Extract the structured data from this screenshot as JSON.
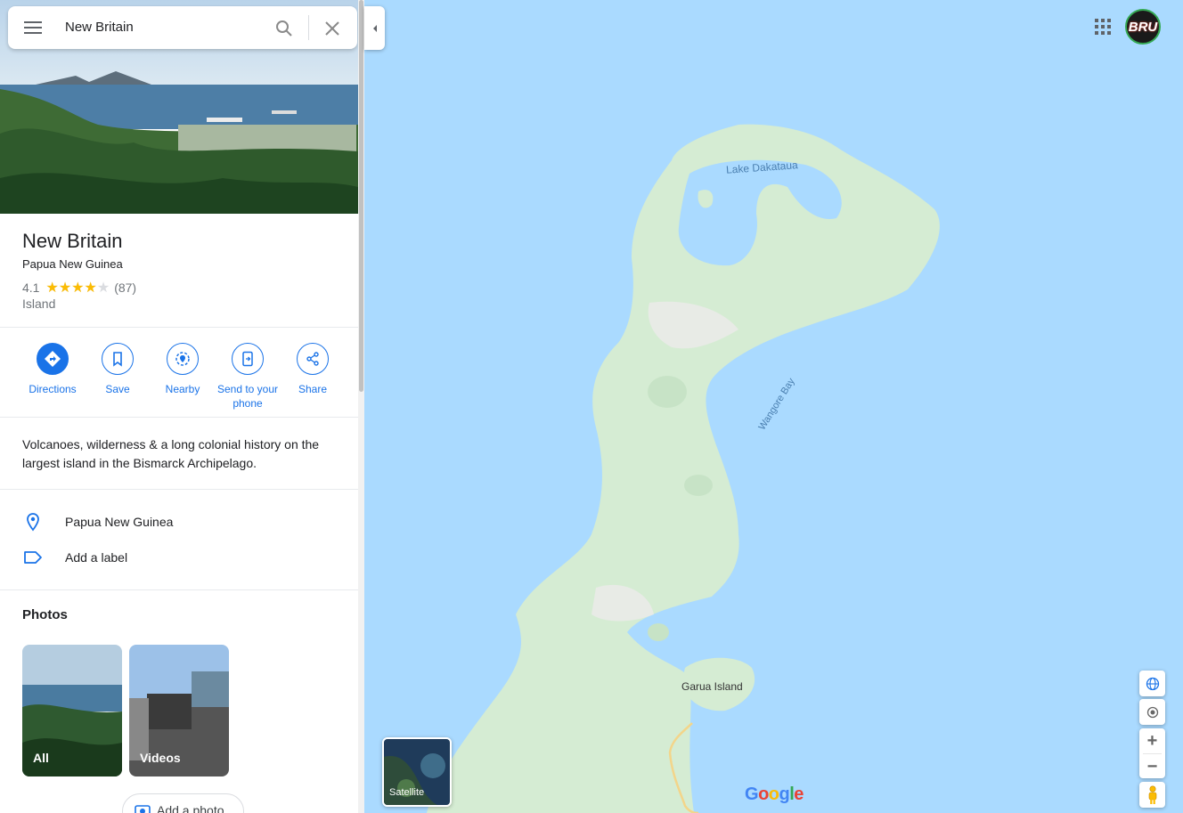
{
  "search": {
    "query": "New Britain"
  },
  "place": {
    "title": "New Britain",
    "subtitle": "Papua New Guinea",
    "rating": "4.1",
    "rating_fraction": 0.82,
    "review_count": "(87)",
    "category": "Island",
    "description": "Volcanoes, wilderness & a long colonial history on the largest island in the Bismarck Archipelago."
  },
  "actions": [
    {
      "label": "Directions",
      "icon": "directions-icon"
    },
    {
      "label": "Save",
      "icon": "bookmark-icon"
    },
    {
      "label": "Nearby",
      "icon": "nearby-icon"
    },
    {
      "label": "Send to your phone",
      "icon": "send-to-phone-icon"
    },
    {
      "label": "Share",
      "icon": "share-icon"
    }
  ],
  "info": {
    "location": "Papua New Guinea",
    "add_label": "Add a label"
  },
  "photos": {
    "heading": "Photos",
    "tiles": [
      "All",
      "Videos"
    ],
    "add_photo": "Add a photo"
  },
  "map": {
    "labels": {
      "lake": "Lake Dakataua",
      "bay": "Wangore Bay",
      "island": "Garua Island"
    },
    "satellite_label": "Satellite",
    "avatar_text": "BRU",
    "logo": "Google"
  },
  "colors": {
    "accent": "#1a73e8",
    "water": "#aadaff",
    "land": "#d4ecd4",
    "star": "#fbbc04"
  }
}
